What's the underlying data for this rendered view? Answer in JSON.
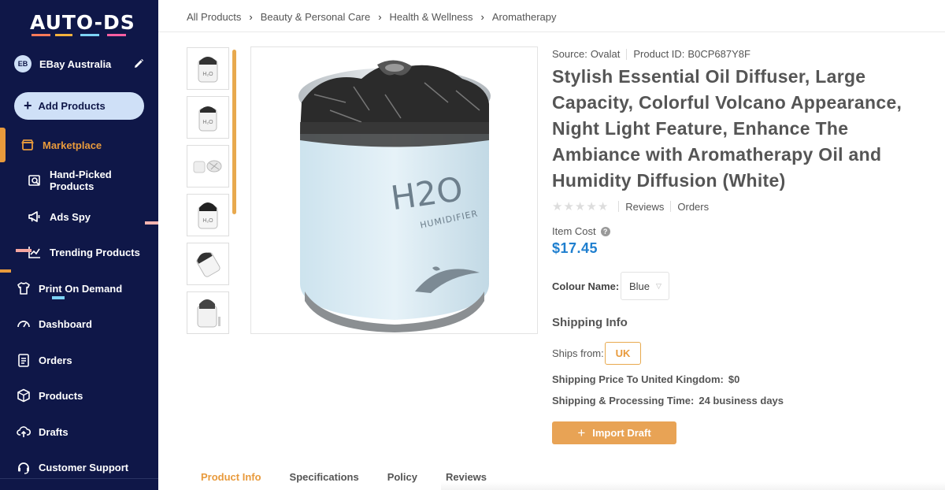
{
  "app": {
    "logo_text": "AUTO-DS",
    "logo_colors": [
      "#ff7a59",
      "#f4b23c",
      "#7dd3f5",
      "#ff5fa2"
    ]
  },
  "sidebar": {
    "account": {
      "initials": "EB",
      "name": "EBay Australia"
    },
    "add_button": "Add Products",
    "items": [
      {
        "label": "Marketplace",
        "icon": "store-icon",
        "active": true
      },
      {
        "label": "Hand-Picked Products",
        "icon": "search-product-icon"
      },
      {
        "label": "Ads Spy",
        "icon": "megaphone-icon"
      },
      {
        "label": "Trending Products",
        "icon": "trending-chart-icon"
      },
      {
        "label": "Print On Demand",
        "icon": "shirt-icon"
      },
      {
        "label": "Dashboard",
        "icon": "gauge-icon"
      },
      {
        "label": "Orders",
        "icon": "clipboard-icon"
      },
      {
        "label": "Products",
        "icon": "box-icon"
      },
      {
        "label": "Drafts",
        "icon": "cloud-upload-icon"
      },
      {
        "label": "Customer Support",
        "icon": "headset-icon"
      }
    ],
    "accent": "#e89a3c",
    "bg": "#0f1748"
  },
  "breadcrumb": [
    "All Products",
    "Beauty & Personal Care",
    "Health & Wellness",
    "Aromatherapy"
  ],
  "product": {
    "source_label": "Source:",
    "source_value": "Ovalat",
    "id_label": "Product ID:",
    "id_value": "B0CP687Y8F",
    "title": "Stylish Essential Oil Diffuser, Large Capacity, Colorful Volcano Appearance, Night Light Feature, Enhance The Ambiance with Aromatherapy Oil and Humidity Diffusion (White)",
    "rating_stars": 0,
    "reviews_label": "Reviews",
    "orders_label": "Orders",
    "item_cost_label": "Item Cost",
    "price": "$17.45",
    "price_color": "#1f7fcf",
    "colour_label": "Colour Name:",
    "colour_value": "Blue",
    "image_text_big": "H2O",
    "image_text_small": "HUMIDIFIER"
  },
  "shipping": {
    "heading": "Shipping Info",
    "ships_from_label": "Ships from:",
    "ships_from_value": "UK",
    "price_label": "Shipping Price To United Kingdom:",
    "price_value": "$0",
    "time_label": "Shipping & Processing Time:",
    "time_value": "24 business days"
  },
  "import_button": "Import Draft",
  "tabs": [
    "Product Info",
    "Specifications",
    "Policy",
    "Reviews"
  ]
}
